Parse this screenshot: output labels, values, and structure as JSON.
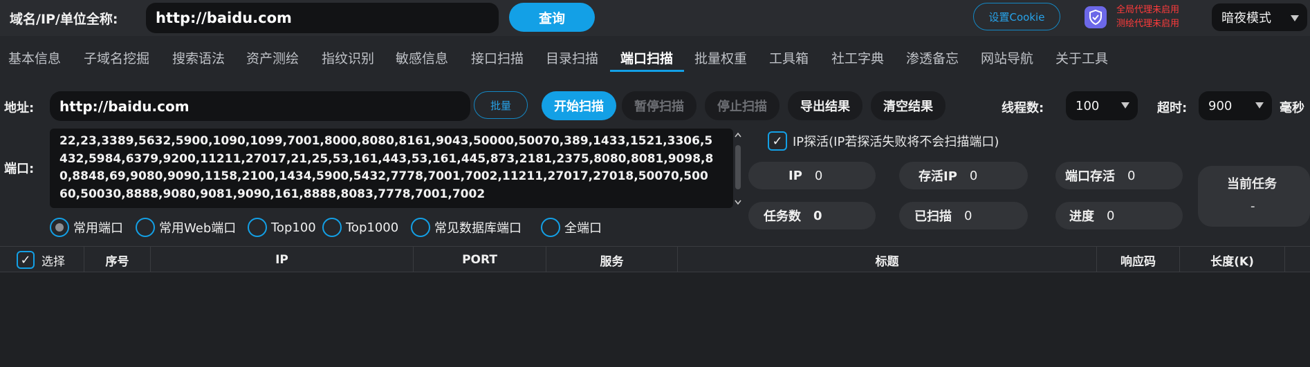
{
  "header": {
    "domain_label": "域名/IP/单位全称:",
    "domain_value": "http://baidu.com",
    "query_button": "查询",
    "cookie_button": "设置Cookie",
    "proxy_line1": "全局代理未启用",
    "proxy_line2": "测绘代理未启用",
    "mode_value": "暗夜模式",
    "shield_icon": "shield-icon",
    "proxy_color": "#ff3b3b",
    "accent_color": "#13a0e6"
  },
  "tabs": [
    {
      "label": "基本信息"
    },
    {
      "label": "子域名挖掘"
    },
    {
      "label": "搜索语法"
    },
    {
      "label": "资产测绘"
    },
    {
      "label": "指纹识别"
    },
    {
      "label": "敏感信息"
    },
    {
      "label": "接口扫描"
    },
    {
      "label": "目录扫描"
    },
    {
      "label": "端口扫描",
      "active": true
    },
    {
      "label": "批量权重"
    },
    {
      "label": "工具箱"
    },
    {
      "label": "社工字典"
    },
    {
      "label": "渗透备忘"
    },
    {
      "label": "网站导航"
    },
    {
      "label": "关于工具"
    }
  ],
  "scan": {
    "address_label": "地址:",
    "address_value": "http://baidu.com",
    "batch_button": "批量",
    "start_button": "开始扫描",
    "pause_button": "暂停扫描",
    "stop_button": "停止扫描",
    "export_button": "导出结果",
    "clear_button": "清空结果",
    "threads_label": "线程数:",
    "threads_value": "100",
    "timeout_label": "超时:",
    "timeout_value": "900",
    "timeout_unit": "毫秒",
    "ports_label": "端口:",
    "ports_value": "22,23,3389,5632,5900,1090,1099,7001,8000,8080,8161,9043,50000,50070,389,1433,1521,3306,5432,5984,6379,9200,11211,27017,21,25,53,161,443,53,161,445,873,2181,2375,8080,8081,9098,80,8848,69,9080,9090,1158,2100,1434,5900,5432,7778,7001,7002,11211,27017,27018,50070,50060,50030,8888,9080,9081,9090,161,8888,8083,7778,7001,7002",
    "ip_probe_label": "IP探活(IP若探活失败将不会扫描端口)",
    "ip_probe_checked": true,
    "radio_options": [
      {
        "label": "常用端口",
        "selected": true
      },
      {
        "label": "常用Web端口",
        "selected": false
      },
      {
        "label": "Top100",
        "selected": false
      },
      {
        "label": "Top1000",
        "selected": false
      },
      {
        "label": "常见数据库端口",
        "selected": false
      },
      {
        "label": "全端口",
        "selected": false
      }
    ]
  },
  "stats": {
    "ip_label": "IP",
    "ip_value": "0",
    "alive_ip_label": "存活IP",
    "alive_ip_value": "0",
    "port_alive_label": "端口存活",
    "port_alive_value": "0",
    "tasks_label": "任务数",
    "tasks_value": "0",
    "scanned_label": "已扫描",
    "scanned_value": "0",
    "progress_label": "进度",
    "progress_value": "0",
    "current_task_label": "当前任务",
    "current_task_value": "-"
  },
  "table": {
    "select_label": "选择",
    "columns": [
      "序号",
      "IP",
      "PORT",
      "服务",
      "标题",
      "响应码",
      "长度(K)"
    ]
  }
}
